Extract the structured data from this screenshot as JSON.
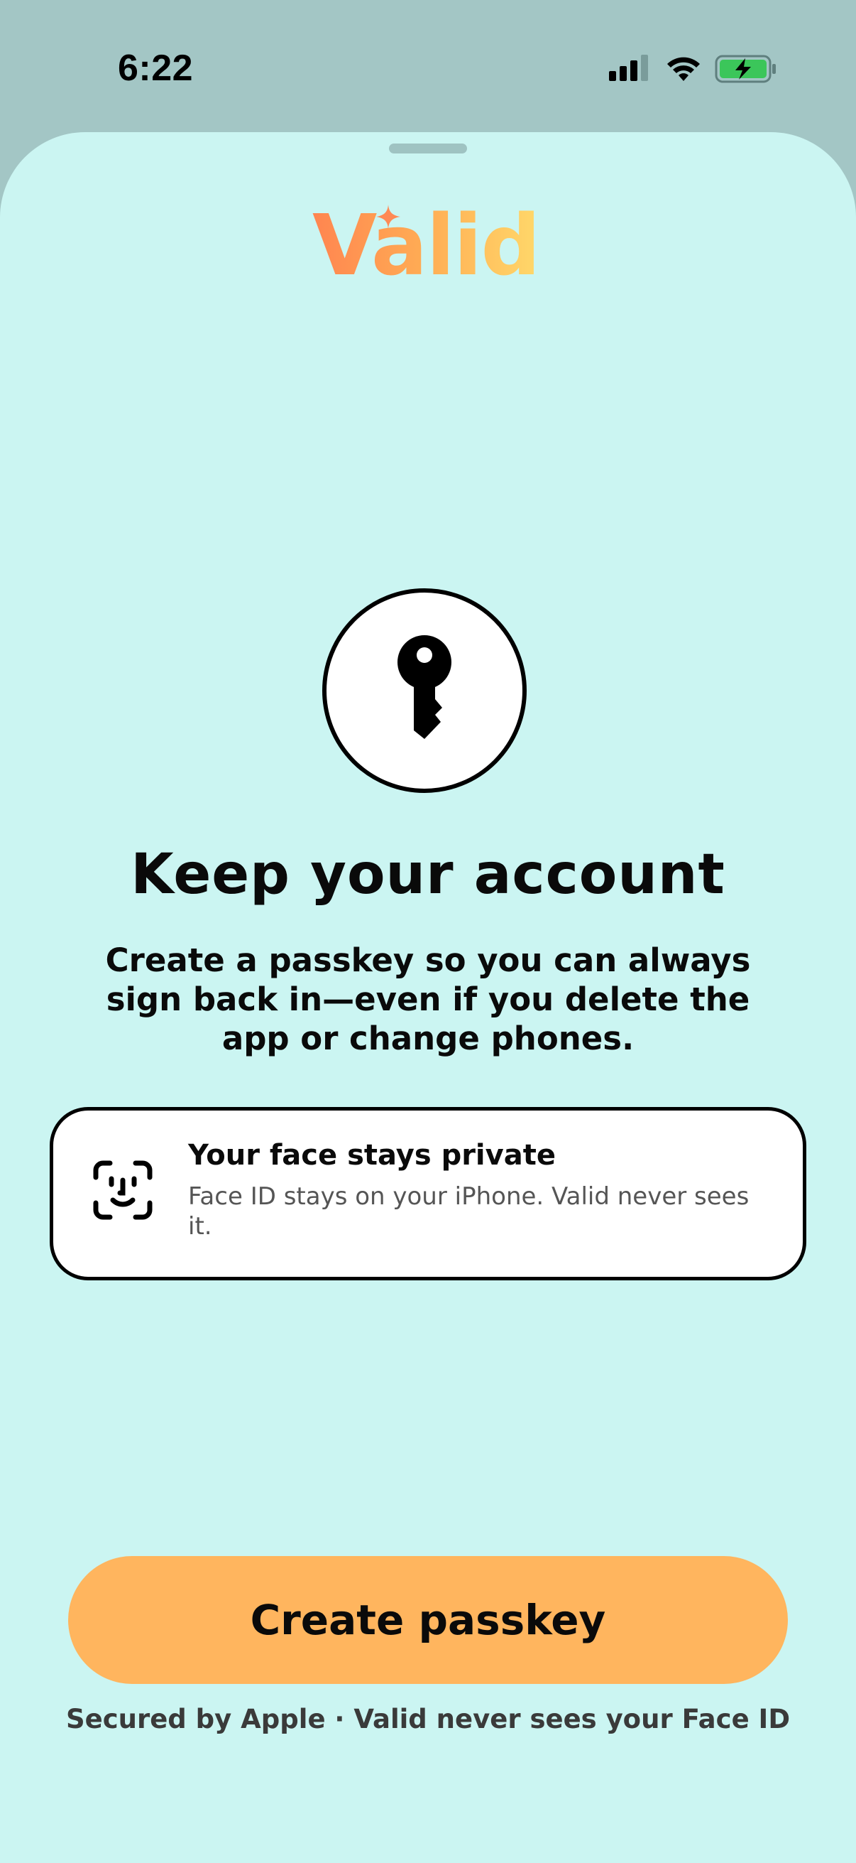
{
  "status_bar": {
    "time": "6:22",
    "icons": [
      "cellular-signal-icon",
      "wifi-icon",
      "battery-charging-icon"
    ]
  },
  "sheet": {
    "logo_text": "Valid",
    "title": "Keep your account",
    "subtitle": "Create a passkey so you can always sign back in—even if you delete the app or change phones.",
    "card": {
      "title": "Your face stays private",
      "body": "Face ID stays on your iPhone. Valid never sees it."
    },
    "cta_label": "Create passkey",
    "footnote": "Secured by Apple · Valid never sees your Face ID"
  },
  "colors": {
    "sheet_bg": "#cbf5f2",
    "backdrop": "#a3c6c5",
    "cta": "#ffb55e",
    "logo_gradient": [
      "#ff8550",
      "#ffd86a"
    ]
  }
}
